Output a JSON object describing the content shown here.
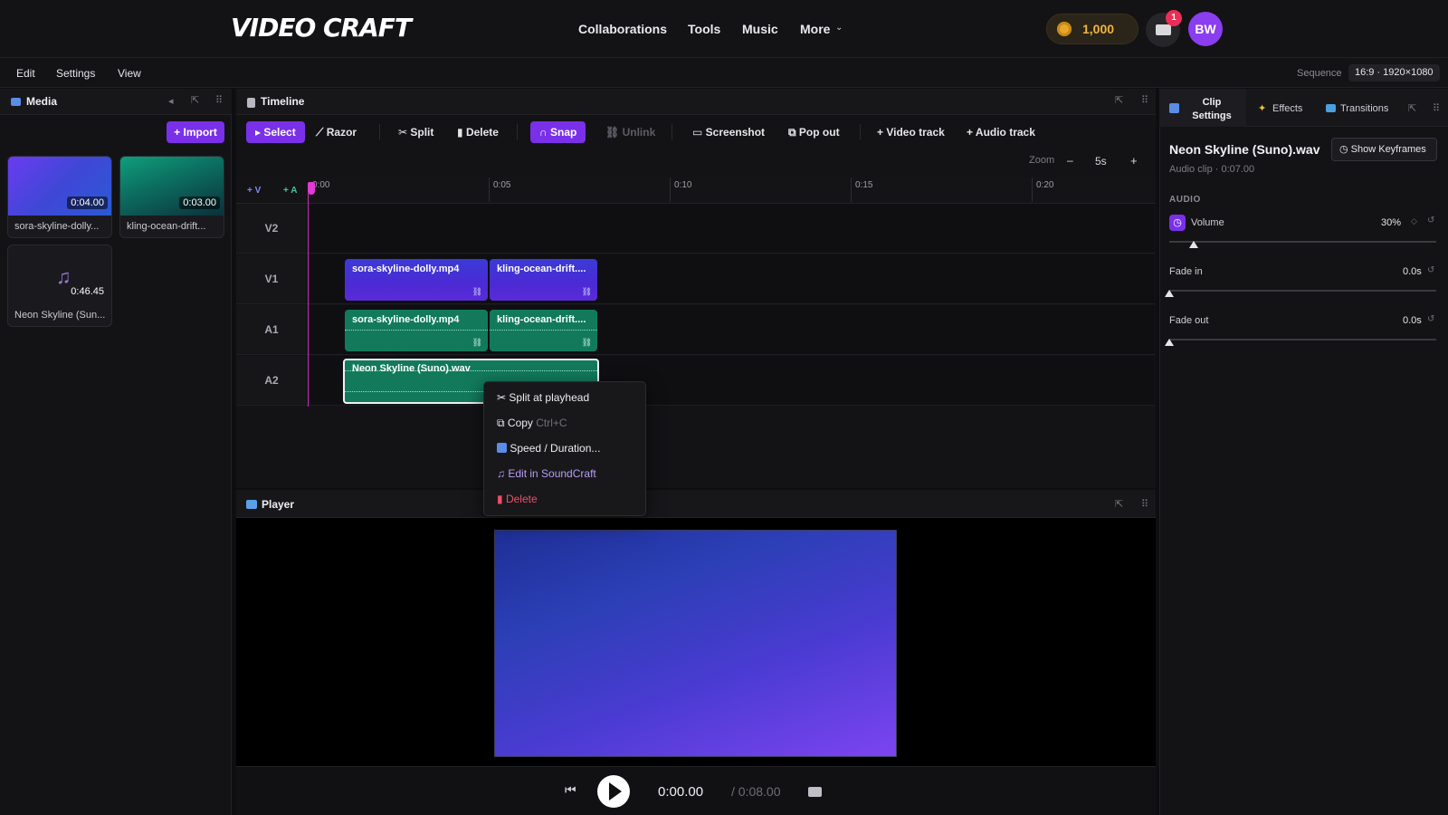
{
  "app": {
    "logo": "VIDEO CRAFT"
  },
  "nav": {
    "links": [
      "Collaborations",
      "Tools",
      "Music",
      "More"
    ]
  },
  "credits": {
    "value": "1,000"
  },
  "notifications": {
    "count": "1"
  },
  "user": {
    "initials": "BW"
  },
  "menubar": {
    "items": [
      "Edit",
      "Settings",
      "View"
    ]
  },
  "sequence": {
    "label": "Sequence",
    "value": "16:9 · 1920×1080"
  },
  "media": {
    "title": "Media",
    "import_label": "+ Import",
    "items": [
      {
        "name": "sora-skyline-dolly...",
        "duration": "0:04.00"
      },
      {
        "name": "kling-ocean-drift...",
        "duration": "0:03.00"
      },
      {
        "name": "Neon Skyline (Sun...",
        "duration": "0:46.45"
      }
    ]
  },
  "timeline": {
    "title": "Timeline",
    "tools": {
      "select": "Select",
      "razor": "Razor",
      "split": "Split",
      "delete": "Delete",
      "snap": "Snap",
      "unlink": "Unlink",
      "screenshot": "Screenshot",
      "popout": "Pop out",
      "add_video": "+ Video track",
      "add_audio": "+ Audio track"
    },
    "zoom": {
      "label": "Zoom",
      "minus": "–",
      "value": "5s",
      "plus": "+"
    },
    "add_v": "+ V",
    "add_a": "+ A",
    "ruler": [
      "0:00",
      "0:05",
      "0:10",
      "0:15",
      "0:20"
    ],
    "tracks": [
      "V2",
      "V1",
      "A1",
      "A2"
    ],
    "clips": {
      "v1_a": "sora-skyline-dolly.mp4",
      "v1_b": "kling-ocean-drift....",
      "a1_a": "sora-skyline-dolly.mp4",
      "a1_b": "kling-ocean-drift....",
      "a2_a": "Neon Skyline (Suno).wav"
    }
  },
  "context_menu": {
    "split": "Split at playhead",
    "copy": "Copy",
    "copy_shortcut": "Ctrl+C",
    "speed": "Speed / Duration...",
    "soundcraft": "Edit in SoundCraft",
    "delete": "Delete"
  },
  "player": {
    "title": "Player",
    "current_time": "0:00.00",
    "total_time": "/ 0:08.00"
  },
  "clip_settings": {
    "tabs": [
      "Clip Settings",
      "Effects",
      "Transitions"
    ],
    "clip_name": "Neon Skyline (Suno).wav",
    "clip_meta": "Audio clip · 0:07.00",
    "keyframes_label": "Show Keyframes",
    "section": "AUDIO",
    "volume": {
      "label": "Volume",
      "value": "30%",
      "level": 0.3
    },
    "fade_in": {
      "label": "Fade in",
      "value": "0.0s",
      "level": 0
    },
    "fade_out": {
      "label": "Fade out",
      "value": "0.0s",
      "level": 0
    }
  },
  "colors": {
    "accent": "#7a30e8",
    "video_clip": "#4b2ad4",
    "audio_clip": "#127a5b",
    "delete": "#ef4e67"
  }
}
